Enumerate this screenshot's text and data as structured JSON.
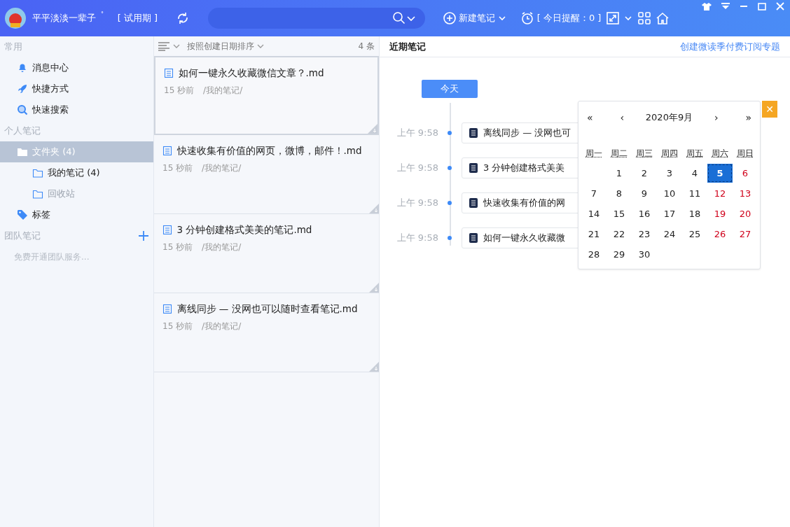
{
  "topbar": {
    "user_name": "平平淡淡一辈子",
    "user_mark": "˚",
    "plan": "[ 试用期 ]",
    "new_note": "新建笔记",
    "reminder": "[ 今日提醒：0 ]"
  },
  "sidebar": {
    "sections": [
      {
        "title": "常用",
        "items": [
          {
            "label": "消息中心",
            "kind": "bell",
            "selected": false
          },
          {
            "label": "快捷方式",
            "kind": "rocket",
            "selected": false
          },
          {
            "label": "快速搜索",
            "kind": "search",
            "selected": false
          }
        ]
      },
      {
        "title": "个人笔记",
        "items": [
          {
            "label": "文件夹 (4)",
            "kind": "folder",
            "selected": true,
            "children": [
              {
                "label": "我的笔记 (4)",
                "kind": "subfolder",
                "selected": false,
                "muted": false
              },
              {
                "label": "回收站",
                "kind": "subfolder",
                "selected": false,
                "muted": true
              }
            ]
          },
          {
            "label": "标签",
            "kind": "tag",
            "selected": false
          }
        ]
      },
      {
        "title": "团队笔记",
        "add": true,
        "hint": "免费开通团队服务..."
      }
    ]
  },
  "note_list": {
    "sort_label": "按照创建日期排序",
    "count": "4 条",
    "notes": [
      {
        "title": "如何一键永久收藏微信文章？.md",
        "time": "15 秒前",
        "path": "/我的笔记/",
        "selected": true
      },
      {
        "title": "快速收集有价值的网页，微博，邮件！.md",
        "time": "15 秒前",
        "path": "/我的笔记/",
        "selected": false
      },
      {
        "title": "3 分钟创建格式美美的笔记.md",
        "time": "15 秒前",
        "path": "/我的笔记/",
        "selected": false
      },
      {
        "title": "离线同步 — 没网也可以随时查看笔记.md",
        "time": "15 秒前",
        "path": "/我的笔记/",
        "selected": false
      }
    ]
  },
  "recent": {
    "title": "近期笔记",
    "link": "创建微读季付费订阅专题",
    "today_button": "今天",
    "entries": [
      {
        "time": "上午 9:58",
        "title": "离线同步 — 没网也可"
      },
      {
        "time": "上午 9:58",
        "title": "3 分钟创建格式美美"
      },
      {
        "time": "上午 9:58",
        "title": "快速收集有价值的网"
      },
      {
        "time": "上午 9:58",
        "title": "如何一键永久收藏微"
      }
    ]
  },
  "calendar": {
    "prev_year": "«",
    "prev_month": "‹",
    "month": "2020年9月",
    "next_month": "›",
    "next_year": "»",
    "close": "✕",
    "weekdays": [
      "周一",
      "周二",
      "周三",
      "周四",
      "周五",
      "周六",
      "周日"
    ],
    "weeks": [
      [
        {
          "day": "1",
          "weekend": false,
          "selected": false
        },
        {
          "day": "2",
          "weekend": false,
          "selected": false
        },
        {
          "day": "3",
          "weekend": false,
          "selected": false
        },
        {
          "day": "4",
          "weekend": false,
          "selected": false
        },
        {
          "day": "5",
          "weekend": true,
          "selected": true
        },
        {
          "day": "6",
          "weekend": true,
          "selected": false
        }
      ],
      [
        {
          "day": "7",
          "weekend": false,
          "selected": false
        },
        {
          "day": "8",
          "weekend": false,
          "selected": false
        },
        {
          "day": "9",
          "weekend": false,
          "selected": false
        },
        {
          "day": "10",
          "weekend": false,
          "selected": false
        },
        {
          "day": "11",
          "weekend": false,
          "selected": false
        },
        {
          "day": "12",
          "weekend": true,
          "selected": false
        },
        {
          "day": "13",
          "weekend": true,
          "selected": false
        }
      ],
      [
        {
          "day": "14",
          "weekend": false,
          "selected": false
        },
        {
          "day": "15",
          "weekend": false,
          "selected": false
        },
        {
          "day": "16",
          "weekend": false,
          "selected": false
        },
        {
          "day": "17",
          "weekend": false,
          "selected": false
        },
        {
          "day": "18",
          "weekend": false,
          "selected": false
        },
        {
          "day": "19",
          "weekend": true,
          "selected": false
        },
        {
          "day": "20",
          "weekend": true,
          "selected": false
        }
      ],
      [
        {
          "day": "21",
          "weekend": false,
          "selected": false
        },
        {
          "day": "22",
          "weekend": false,
          "selected": false
        },
        {
          "day": "23",
          "weekend": false,
          "selected": false
        },
        {
          "day": "24",
          "weekend": false,
          "selected": false
        },
        {
          "day": "25",
          "weekend": false,
          "selected": false
        },
        {
          "day": "26",
          "weekend": true,
          "selected": false
        },
        {
          "day": "27",
          "weekend": true,
          "selected": false
        }
      ],
      [
        {
          "day": "28",
          "weekend": false,
          "selected": false
        },
        {
          "day": "29",
          "weekend": false,
          "selected": false
        },
        {
          "day": "30",
          "weekend": false,
          "selected": false
        }
      ]
    ]
  }
}
